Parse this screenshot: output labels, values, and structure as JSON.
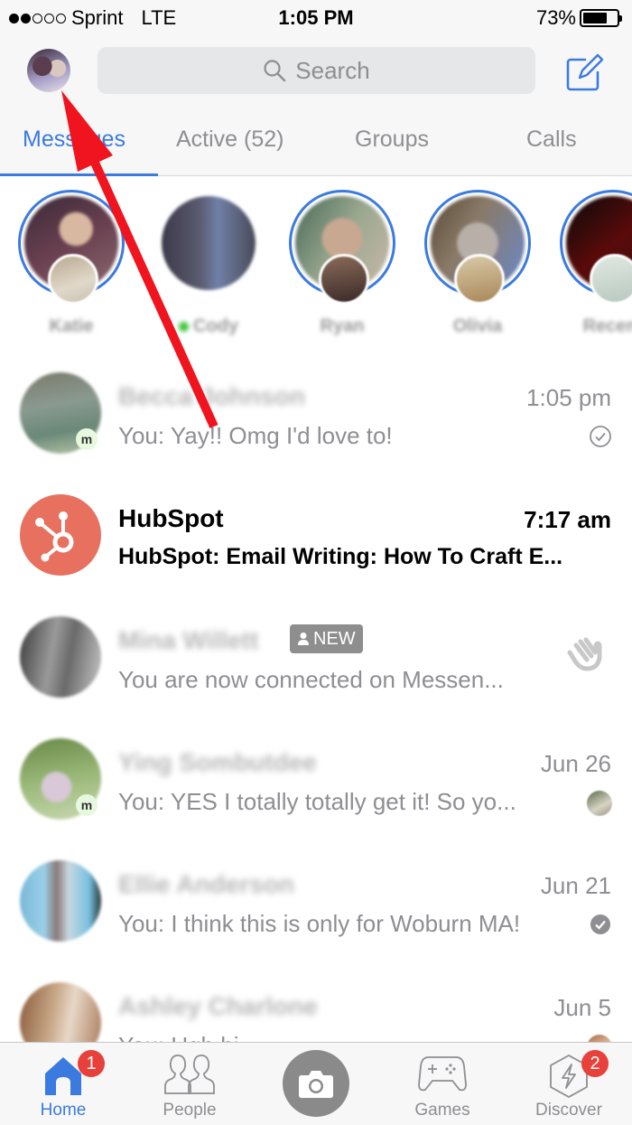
{
  "status_bar": {
    "signal_bars_filled": 2,
    "signal_bars_total": 5,
    "carrier": "Sprint",
    "network": "LTE",
    "time": "1:05 PM",
    "battery_percent_label": "73%",
    "battery_level": 0.73
  },
  "header": {
    "search_placeholder": "Search",
    "profile_icon": "profile-avatar",
    "compose_icon": "compose-icon"
  },
  "tabs": [
    {
      "label": "Messages",
      "active": true
    },
    {
      "label": "Active (52)",
      "active": false
    },
    {
      "label": "Groups",
      "active": false
    },
    {
      "label": "Calls",
      "active": false
    }
  ],
  "stories": [
    {
      "name": "Katie",
      "has_story_ring": true,
      "online": false
    },
    {
      "name": "Cody",
      "has_story_ring": false,
      "online": true
    },
    {
      "name": "Ryan",
      "has_story_ring": true,
      "online": false
    },
    {
      "name": "Olivia",
      "has_story_ring": true,
      "online": false
    },
    {
      "name": "Recent",
      "has_story_ring": true,
      "online": false
    }
  ],
  "conversations": [
    {
      "name": "Becca Johnson",
      "name_blurred": true,
      "time": "1:05 pm",
      "preview": "You: Yay!! Omg I'd love to!",
      "unread": false,
      "status": "sent-check-outline",
      "messenger_badge": true
    },
    {
      "name": "HubSpot",
      "name_blurred": false,
      "time": "7:17 am",
      "preview": "HubSpot: Email Writing: How To Craft E...",
      "unread": true,
      "status": "none",
      "messenger_badge": false
    },
    {
      "name": "Mina Willett",
      "name_blurred": true,
      "time": "",
      "badge": "NEW",
      "preview": "You are now connected on Messen...",
      "unread": false,
      "status": "wave-hand",
      "messenger_badge": false
    },
    {
      "name": "Ying Sombutdee",
      "name_blurred": true,
      "time": "Jun 26",
      "preview": "You: YES I totally totally get it! So yo...",
      "unread": false,
      "status": "seen-avatar",
      "messenger_badge": true
    },
    {
      "name": "Ellie Anderson",
      "name_blurred": true,
      "time": "Jun 21",
      "preview": "You: I think this is only for Woburn MA!",
      "unread": false,
      "status": "delivered-check-filled",
      "messenger_badge": false
    },
    {
      "name": "Ashley Charlone",
      "name_blurred": true,
      "time": "Jun 5",
      "preview": "You: Ugh hi",
      "unread": false,
      "status": "seen-avatar",
      "messenger_badge": false
    }
  ],
  "messenger_badge_letter": "m",
  "bottom_nav": [
    {
      "label": "Home",
      "icon": "home-icon",
      "active": true,
      "badge": "1"
    },
    {
      "label": "People",
      "icon": "people-icon",
      "active": false,
      "badge": ""
    },
    {
      "label": "",
      "icon": "camera-icon",
      "active": false,
      "badge": ""
    },
    {
      "label": "Games",
      "icon": "gamepad-icon",
      "active": false,
      "badge": ""
    },
    {
      "label": "Discover",
      "icon": "discover-icon",
      "active": false,
      "badge": "2"
    }
  ],
  "colors": {
    "accent": "#3b7be0",
    "badge": "#e8403a",
    "hubspot": "#e8705f",
    "annotation_arrow": "#f0141e",
    "online": "#42c63c"
  }
}
